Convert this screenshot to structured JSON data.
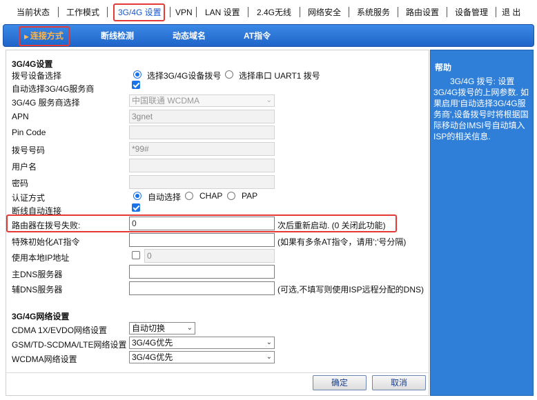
{
  "topnav": {
    "items": [
      "当前状态",
      "工作模式",
      "3G/4G 设置",
      "VPN",
      "LAN 设置",
      "2.4G无线",
      "网络安全",
      "系统服务",
      "路由设置",
      "设备管理",
      "退 出"
    ],
    "active_index": 2
  },
  "subtabs": {
    "items": [
      "连接方式",
      "断线检测",
      "动态域名",
      "AT指令"
    ],
    "active_index": 0
  },
  "settings": {
    "section_title": "3G/4G设置",
    "dial_device": {
      "label": "拨号设备选择",
      "option_3g4g": "选择3G/4G设备拨号",
      "option_uart": "选择串口 UART1 拨号",
      "selected": "option_3g4g"
    },
    "auto_select_provider": {
      "label": "自动选择3G/4G服务商",
      "checked": true
    },
    "provider": {
      "label": "3G/4G 服务商选择",
      "value": "中国联通 WCDMA"
    },
    "apn": {
      "label": "APN",
      "value": "3gnet"
    },
    "pin_code": {
      "label": "Pin Code",
      "value": ""
    },
    "dial_number": {
      "label": "拨号号码",
      "value": "*99#"
    },
    "username": {
      "label": "用户名",
      "value": ""
    },
    "password": {
      "label": "密码",
      "value": ""
    },
    "auth": {
      "label": "认证方式",
      "option_auto": "自动选择",
      "option_chap": "CHAP",
      "option_pap": "PAP",
      "selected": "option_auto"
    },
    "auto_reconnect": {
      "label": "断线自动连接",
      "checked": true
    },
    "reboot_on_fail": {
      "label": "路由器在拨号失败:",
      "value": "0",
      "suffix": "次后重新启动. (0 关闭此功能)"
    },
    "init_at": {
      "label": "特殊初始化AT指令",
      "value": "",
      "hint": "(如果有多条AT指令，请用';'号分隔)"
    },
    "local_ip": {
      "label": "使用本地IP地址",
      "checked": false,
      "value": "0"
    },
    "primary_dns": {
      "label": "主DNS服务器",
      "value": ""
    },
    "secondary_dns": {
      "label": "辅DNS服务器",
      "value": "",
      "hint": "(可选,不填写则使用ISP远程分配的DNS)"
    }
  },
  "network": {
    "section_title": "3G/4G网络设置",
    "cdma": {
      "label": "CDMA 1X/EVDO网络设置",
      "value": "自动切换"
    },
    "gsm": {
      "label": "GSM/TD-SCDMA/LTE网络设置",
      "value": "3G/4G优先"
    },
    "wcdma": {
      "label": "WCDMA网络设置",
      "value": "3G/4G优先"
    }
  },
  "buttons": {
    "confirm": "确定",
    "cancel": "取消"
  },
  "help": {
    "title": "帮助",
    "text": "3G/4G 拨号: 设置3G/4G拨号的上网参数. 如果启用'自动选择3G/4G服务商',设备拨号时将根据国际移动台IMSI号自动填入ISP的相关信息."
  },
  "colors": {
    "accent": "#2f7fd8",
    "highlight": "#e53935",
    "active_tab_text": "#ffb74d"
  }
}
